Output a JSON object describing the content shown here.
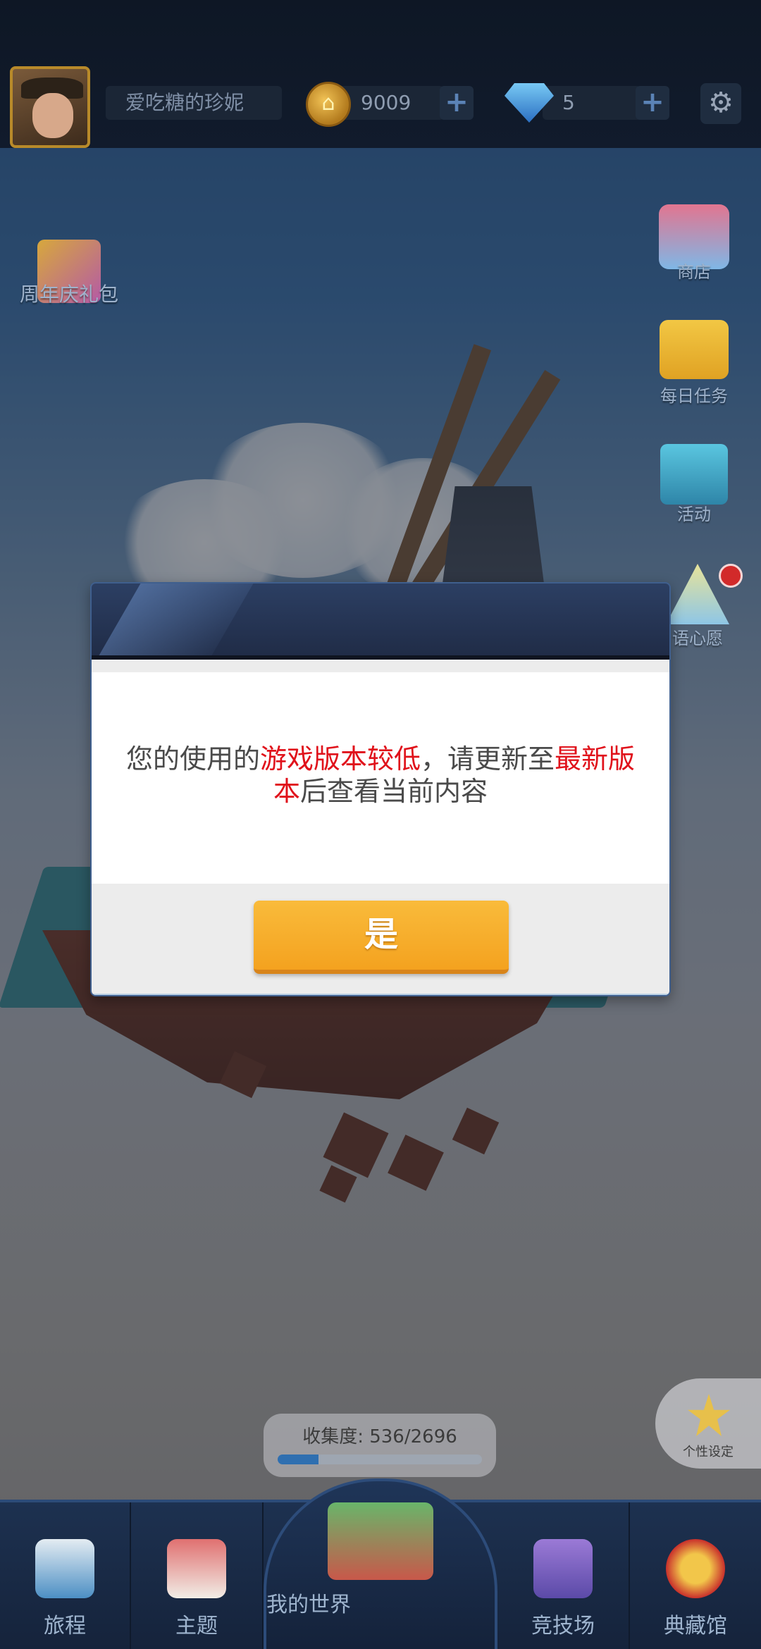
{
  "player": {
    "name": "爱吃糖的珍妮"
  },
  "resources": {
    "coins": "9009",
    "gems": "5",
    "plus": "+"
  },
  "settings_icon": "gear-icon",
  "side_left": {
    "gift_label": "周年庆礼包"
  },
  "side_right": [
    {
      "label": "商店",
      "icon": "shop-bag-icon"
    },
    {
      "label": "每日任务",
      "icon": "calendar-check-icon"
    },
    {
      "label": "活动",
      "icon": "gift-box-icon"
    },
    {
      "label": "语心愿",
      "icon": "wish-icon"
    }
  ],
  "dialog": {
    "msg_part1": "您的使用的",
    "msg_hl1": "游戏版本较低",
    "msg_part2": "，请更新至",
    "msg_hl2": "最新版本",
    "msg_part3": "后查看当前内容",
    "confirm_label": "是",
    "highlight_color": "#e0121b",
    "button_color": "#f4a21f"
  },
  "collection": {
    "label": "收集度: 536/2696",
    "current": 536,
    "total": 2696
  },
  "customize": {
    "label": "个性设定"
  },
  "nav": [
    {
      "label": "旅程",
      "icon": "camera-icon"
    },
    {
      "label": "主题",
      "icon": "house-icon"
    },
    {
      "label": "我的世界",
      "icon": "island-world-icon"
    },
    {
      "label": "竞技场",
      "icon": "crown-shield-icon"
    },
    {
      "label": "典藏馆",
      "icon": "star-medal-icon"
    }
  ]
}
